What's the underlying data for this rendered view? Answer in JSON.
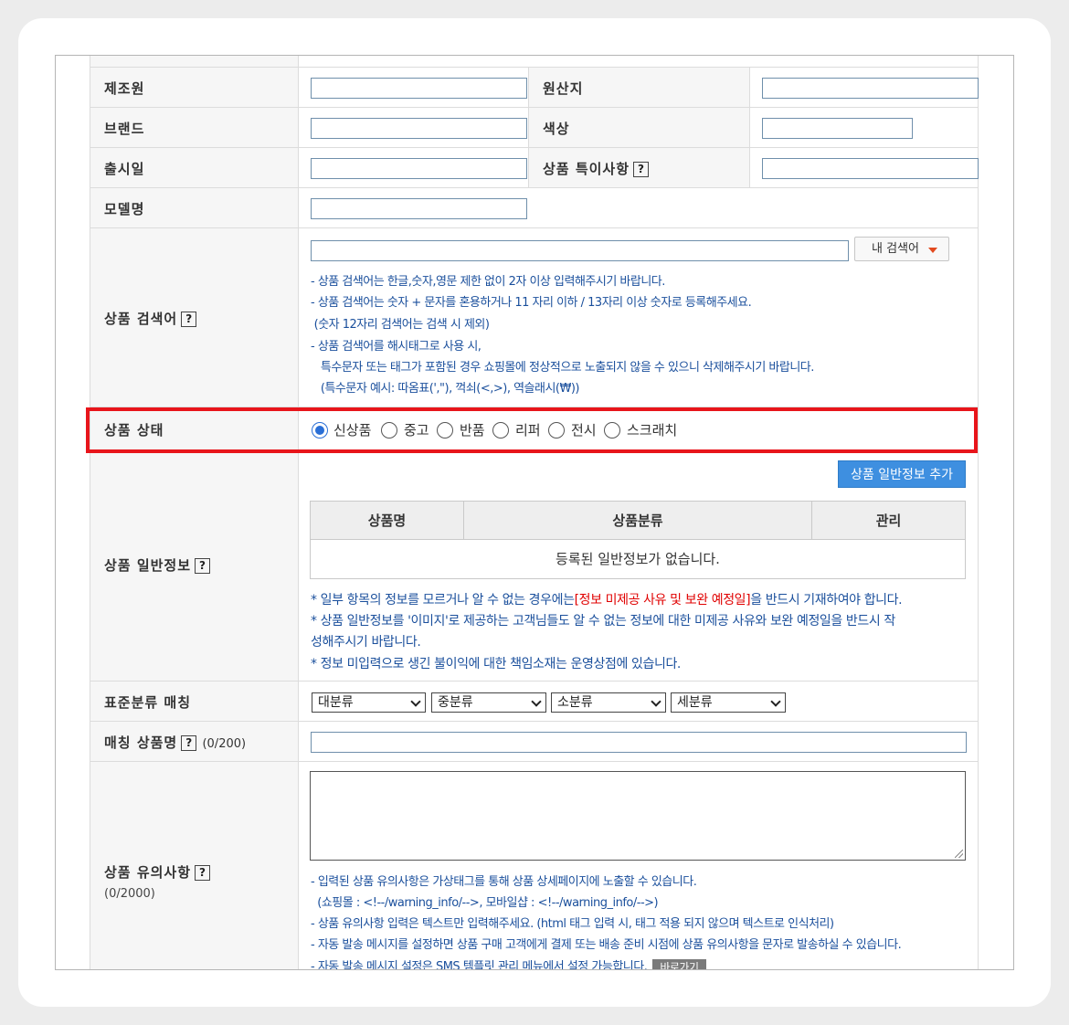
{
  "rows": {
    "manufacturer": {
      "label": "제조원"
    },
    "origin": {
      "label": "원산지"
    },
    "brand": {
      "label": "브랜드"
    },
    "color": {
      "label": "색상"
    },
    "release_date": {
      "label": "출시일"
    },
    "special_notes": {
      "label": "상품 특이사항"
    },
    "model_name": {
      "label": "모델명"
    }
  },
  "help_glyph": "?",
  "search_keyword": {
    "label": "상품 검색어",
    "my_keywords_button": "내 검색어",
    "notes": [
      "- 상품 검색어는 한글,숫자,영문 제한 없이 2자 이상 입력해주시기 바랍니다.",
      "- 상품 검색어는 숫자 + 문자를 혼용하거나 11 자리 이하 / 13자리 이상 숫자로 등록해주세요.",
      " (숫자 12자리 검색어는 검색 시 제외)",
      "- 상품 검색어를 해시태그로 사용 시,",
      "   특수문자 또는 태그가 포함된 경우 쇼핑몰에 정상적으로 노출되지 않을 수 있으니 삭제해주시기 바랍니다.",
      "   (특수문자 예시: 따옴표(',\"), 꺽쇠(<,>), 역슬래시(₩))"
    ]
  },
  "condition": {
    "label": "상품 상태",
    "options": [
      "신상품",
      "중고",
      "반품",
      "리퍼",
      "전시",
      "스크래치"
    ],
    "selected": "신상품"
  },
  "general_info": {
    "label": "상품 일반정보",
    "add_button": "상품 일반정보 추가",
    "columns": [
      "상품명",
      "상품분류",
      "관리"
    ],
    "empty_text": "등록된 일반정보가 없습니다.",
    "notes": {
      "line1_pre": "* 일부 항목의 정보를 모르거나 알 수 없는 경우에는",
      "line1_red": "[정보 미제공 사유 및 보완 예정일]",
      "line1_post": "을 반드시 기재하여야 합니다.",
      "line2": "* 상품 일반정보를 '이미지'로 제공하는 고객님들도 알 수 없는 정보에 대한 미제공 사유와 보완 예정일을 반드시 작",
      "line3": "성해주시기 바랍니다.",
      "line4": "* 정보 미입력으로 생긴 불이익에 대한 책임소재는 운영상점에 있습니다."
    }
  },
  "standard_category": {
    "label": "표준분류 매칭",
    "selects": [
      "대분류",
      "중분류",
      "소분류",
      "세분류"
    ]
  },
  "matching_name": {
    "label": "매칭 상품명",
    "counter": "(0/200)"
  },
  "caution": {
    "label": "상품 유의사항",
    "counter": "(0/2000)",
    "notes": [
      "- 입력된 상품 유의사항은 가상태그를 통해 상품 상세페이지에 노출할 수 있습니다.",
      "  (쇼핑몰 : <!--/warning_info/-->, 모바일샵 : <!--/warning_info/-->)",
      "- 상품 유의사항 입력은 텍스트만 입력해주세요. (html 태그 입력 시, 태그 적용 되지 않으며 텍스트로 인식처리)",
      "- 자동 발송 메시지를 설정하면 상품 구매 고객에게 결제 또는 배송 준비 시점에 상품 유의사항을 문자로 발송하실 수 있습니다."
    ],
    "last_note": "- 자동 발송 메시지 설정은 SMS 템플릿 관리 메뉴에서 설정 가능합니다.",
    "shortcut_button": "바로가기"
  }
}
